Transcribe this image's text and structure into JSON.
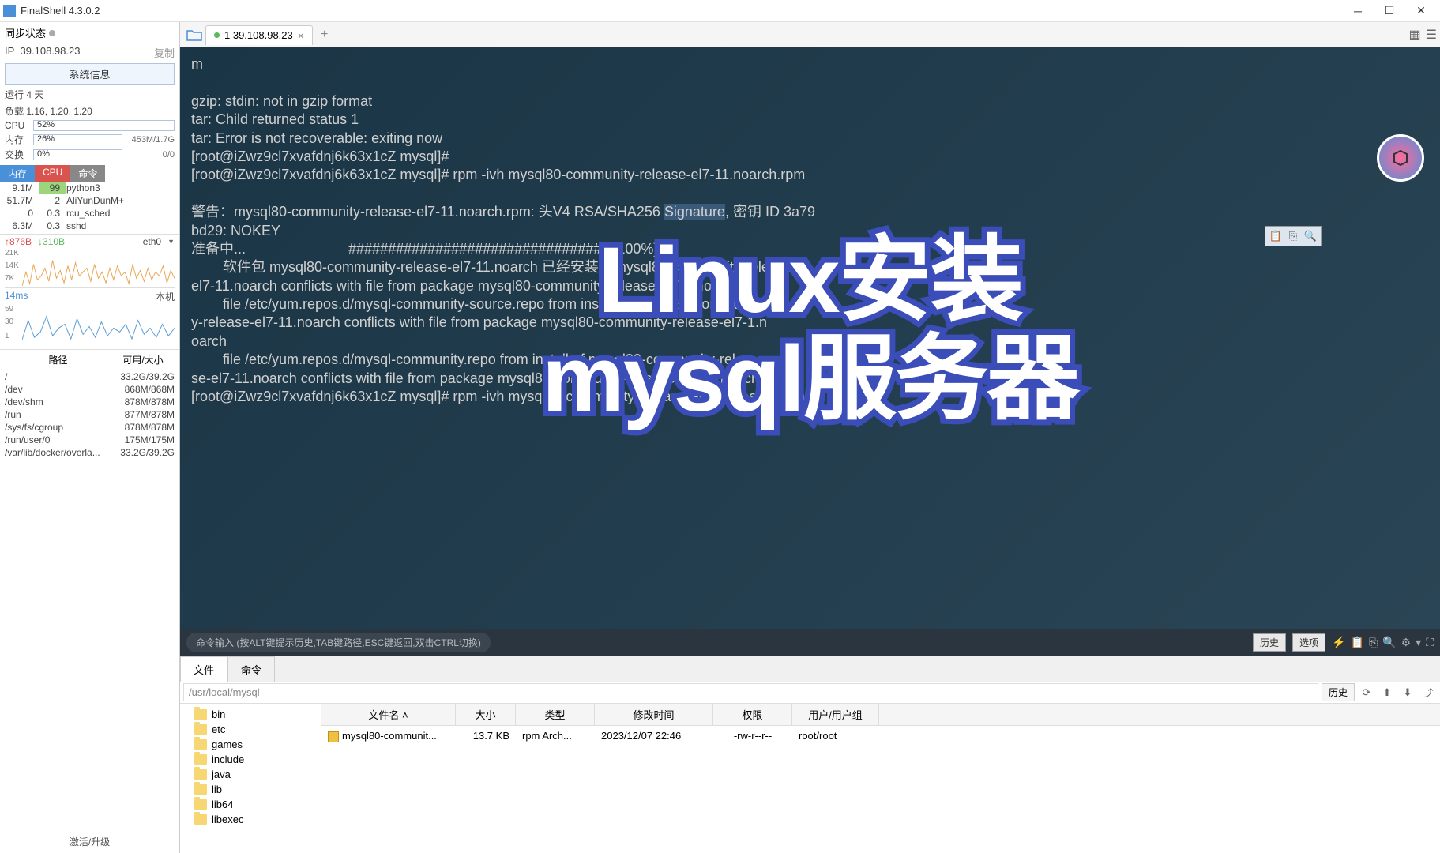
{
  "titlebar": {
    "app_name": "FinalShell 4.3.0.2"
  },
  "sidebar": {
    "sync_label": "同步状态",
    "ip_label": "IP",
    "ip_value": "39.108.98.23",
    "copy_label": "复制",
    "sysinfo_btn": "系统信息",
    "uptime": "运行 4 天",
    "load": "负载 1.16, 1.20, 1.20",
    "cpu": {
      "label": "CPU",
      "pct": "52%",
      "fill": 52,
      "color": "#9cd67c"
    },
    "mem": {
      "label": "内存",
      "pct": "26%",
      "fill": 26,
      "color": "#f5b971",
      "detail": "453M/1.7G"
    },
    "swap": {
      "label": "交换",
      "pct": "0%",
      "fill": 0,
      "detail": "0/0"
    },
    "tabs": {
      "mem": "内存",
      "cpu": "CPU",
      "cmd": "命令"
    },
    "procs": [
      {
        "mem": "9.1M",
        "cpu": "99",
        "name": "python3",
        "hl": true
      },
      {
        "mem": "51.7M",
        "cpu": "2",
        "name": "AliYunDunM+"
      },
      {
        "mem": "0",
        "cpu": "0.3",
        "name": "rcu_sched"
      },
      {
        "mem": "6.3M",
        "cpu": "0.3",
        "name": "sshd"
      }
    ],
    "net": {
      "up": "↑876B",
      "down": "↓310B",
      "iface": "eth0"
    },
    "net_ylabels": [
      "21K",
      "14K",
      "7K"
    ],
    "latency": "14ms",
    "latency_host": "本机",
    "lat_ylabels": [
      "59",
      "30",
      "1"
    ],
    "disk_hdr": {
      "path": "路径",
      "size": "可用/大小"
    },
    "disks": [
      {
        "path": "/",
        "size": "33.2G/39.2G"
      },
      {
        "path": "/dev",
        "size": "868M/868M"
      },
      {
        "path": "/dev/shm",
        "size": "878M/878M"
      },
      {
        "path": "/run",
        "size": "877M/878M"
      },
      {
        "path": "/sys/fs/cgroup",
        "size": "878M/878M"
      },
      {
        "path": "/run/user/0",
        "size": "175M/175M"
      },
      {
        "path": "/var/lib/docker/overla...",
        "size": "33.2G/39.2G"
      }
    ],
    "activate": "激活/升级"
  },
  "tabbar": {
    "tab_label": "1 39.108.98.23"
  },
  "terminal": {
    "m": "m",
    "lines": [
      "gzip: stdin: not in gzip format",
      "tar: Child returned status 1",
      "tar: Error is not recoverable: exiting now",
      "[root@iZwz9cl7xvafdnj6k63x1cZ mysql]#",
      "[root@iZwz9cl7xvafdnj6k63x1cZ mysql]# rpm -ivh mysql80-community-release-el7-11.noarch.rpm",
      "",
      "警告：mysql80-community-release-el7-11.noarch.rpm: 头V4 RSA/SHA256 Signature, 密钥 ID 3a79",
      "bd29: NOKEY",
      "准备中...                          ################################# [100%]",
      "        软件包 mysql80-community-release-el7-11.noarch 已经安装    mysql80-community-release-",
      "el7-11.noarch conflicts with file from package mysql80-community-release-el7-1.noarch",
      "        file /etc/yum.repos.d/mysql-community-source.repo from install of mysql80-communit",
      "y-release-el7-11.noarch conflicts with file from package mysql80-community-release-el7-1.n",
      "oarch",
      "        file /etc/yum.repos.d/mysql-community.repo from install of mysql80-community-relea",
      "se-el7-11.noarch conflicts with file from package mysql80-community-release-el7-1.noarch",
      "[root@iZwz9cl7xvafdnj6k63x1cZ mysql]# rpm -ivh mysql80-community-release-el7-11.noarch.rpm"
    ],
    "highlight_word": "Signature",
    "overlay_line1": "Linux安装",
    "overlay_line2": "mysql服务器"
  },
  "cmdbar": {
    "hint": "命令输入 (按ALT键提示历史,TAB键路径,ESC键返回,双击CTRL切换)",
    "history": "历史",
    "options": "选项"
  },
  "filepane": {
    "tabs": {
      "files": "文件",
      "cmd": "命令"
    },
    "path": "/usr/local/mysql",
    "history_btn": "历史",
    "tree": [
      "bin",
      "etc",
      "games",
      "include",
      "java",
      "lib",
      "lib64",
      "libexec"
    ],
    "hdr": {
      "name": "文件名",
      "size": "大小",
      "type": "类型",
      "mtime": "修改时间",
      "perm": "权限",
      "owner": "用户/用户组"
    },
    "rows": [
      {
        "name": "mysql80-communit...",
        "size": "13.7 KB",
        "type": "rpm Arch...",
        "mtime": "2023/12/07 22:46",
        "perm": "-rw-r--r--",
        "owner": "root/root"
      }
    ]
  }
}
